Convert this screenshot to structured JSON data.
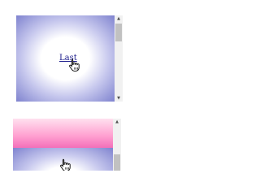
{
  "top_frame": {
    "link_text": "Last",
    "cursor_icon": "hand-pointer-icon"
  },
  "bottom_frame": {
    "cursor_icon": "hand-pointer-icon"
  },
  "scrollbar": {
    "up_arrow": "▲",
    "down_arrow": "▼"
  },
  "colors": {
    "gradient_edge": "#7f83cf",
    "gradient_center": "#ffffff",
    "pink_band": "#f36fb9",
    "scrollbar_track": "#f1f1f1",
    "scrollbar_thumb": "#c1c1c1"
  }
}
